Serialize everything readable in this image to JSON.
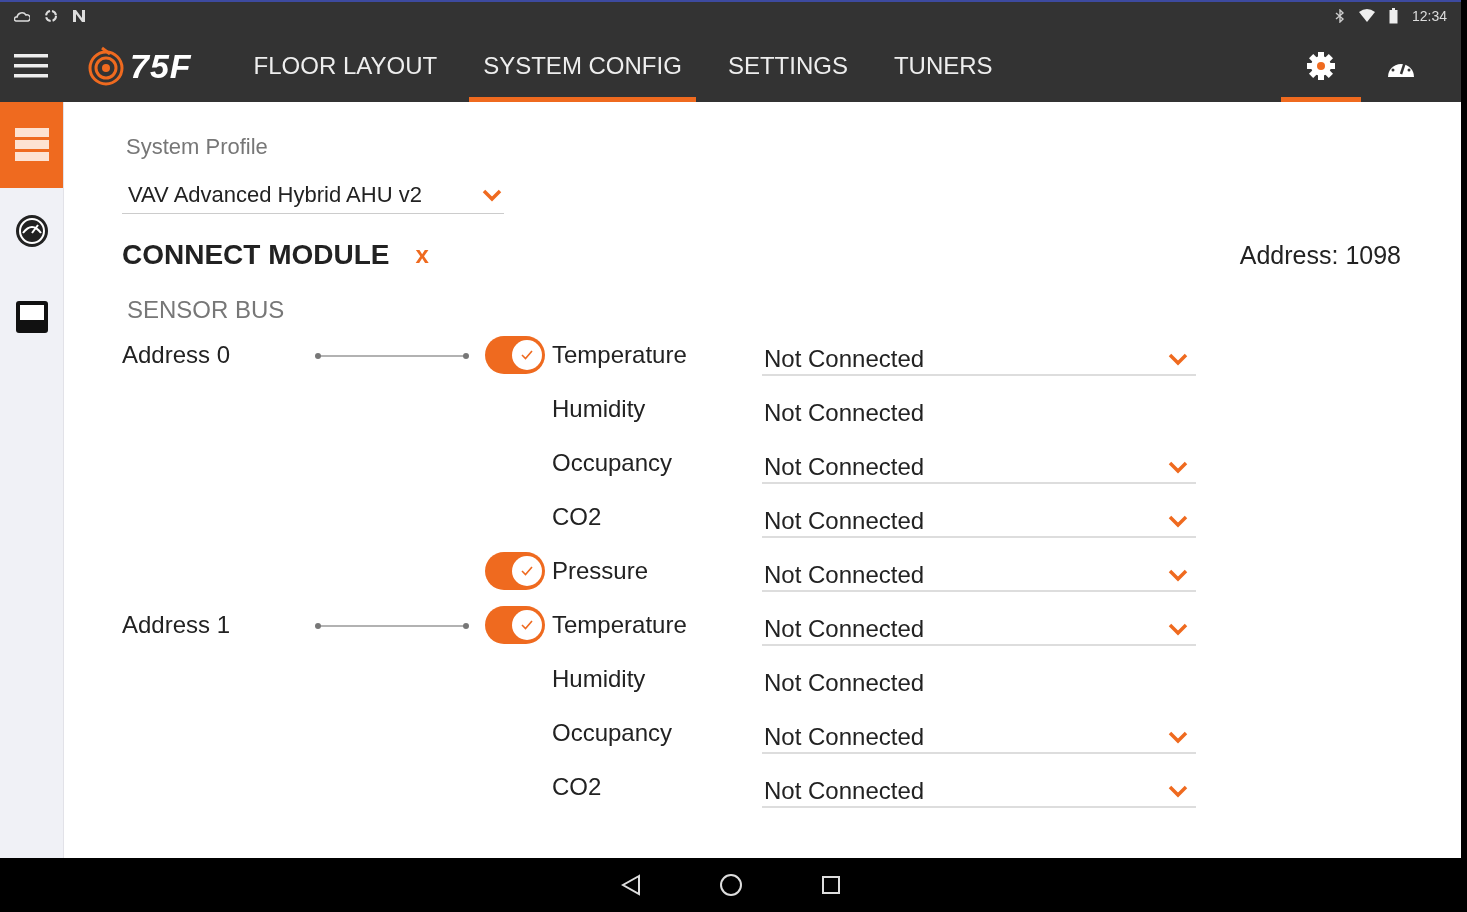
{
  "status_bar": {
    "time": "12:34"
  },
  "nav": {
    "logo": "75F",
    "tabs": [
      {
        "label": "FLOOR LAYOUT",
        "selected": false
      },
      {
        "label": "SYSTEM CONFIG",
        "selected": true
      },
      {
        "label": "SETTINGS",
        "selected": false
      },
      {
        "label": "TUNERS",
        "selected": false
      }
    ],
    "icon_tabs": [
      {
        "kind": "settings",
        "selected": true
      },
      {
        "kind": "dashboard",
        "selected": false
      }
    ]
  },
  "sidebar": {
    "items": [
      {
        "kind": "list",
        "selected": true
      },
      {
        "kind": "gauge",
        "selected": false
      },
      {
        "kind": "device",
        "selected": false
      }
    ]
  },
  "system_profile": {
    "label": "System Profile",
    "value": "VAV Advanced Hybrid AHU v2"
  },
  "module": {
    "title": "CONNECT MODULE",
    "close": "x",
    "address": "Address: 1098"
  },
  "sensor_bus": {
    "title": "SENSOR BUS",
    "groups": [
      {
        "address": "Address 0",
        "sensors": [
          {
            "kind": "switch",
            "on": true,
            "label": "Temperature",
            "value": "Not Connected",
            "dropdown": true
          },
          {
            "kind": "plain",
            "label": "Humidity",
            "value": "Not Connected",
            "dropdown": false
          },
          {
            "kind": "plain",
            "label": "Occupancy",
            "value": "Not Connected",
            "dropdown": true
          },
          {
            "kind": "plain",
            "label": "CO2",
            "value": "Not Connected",
            "dropdown": true
          },
          {
            "kind": "switch",
            "on": true,
            "label": "Pressure",
            "value": "Not Connected",
            "dropdown": true
          }
        ]
      },
      {
        "address": "Address 1",
        "sensors": [
          {
            "kind": "switch",
            "on": true,
            "label": "Temperature",
            "value": "Not Connected",
            "dropdown": true
          },
          {
            "kind": "plain",
            "label": "Humidity",
            "value": "Not Connected",
            "dropdown": false
          },
          {
            "kind": "plain",
            "label": "Occupancy",
            "value": "Not Connected",
            "dropdown": true
          },
          {
            "kind": "plain",
            "label": "CO2",
            "value": "Not Connected",
            "dropdown": true
          }
        ]
      }
    ]
  }
}
